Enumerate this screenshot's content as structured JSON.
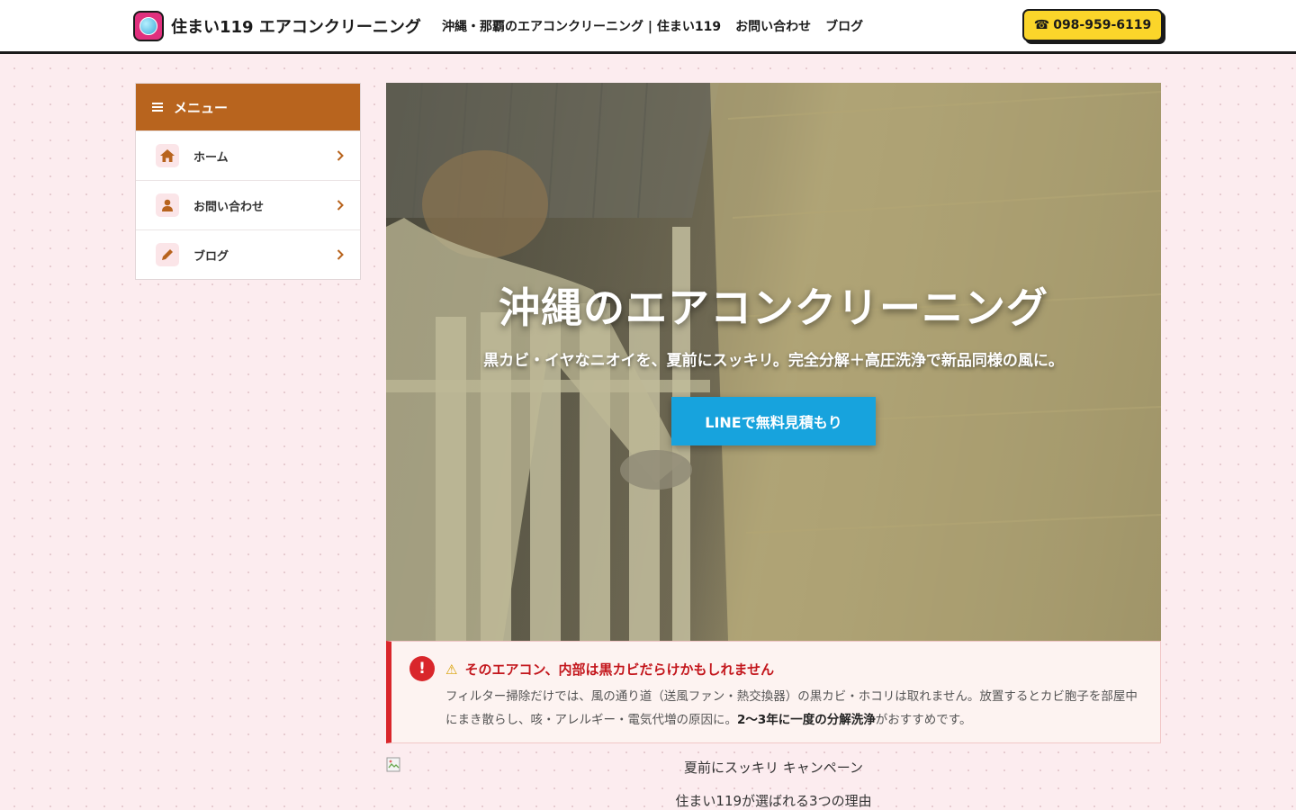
{
  "header": {
    "site_title": "住まい119 エアコンクリーニング",
    "nav": [
      {
        "label": "沖縄・那覇のエアコンクリーニング | 住まい119"
      },
      {
        "label": "お問い合わせ"
      },
      {
        "label": "ブログ"
      }
    ],
    "phone_icon": "☎",
    "phone": "098-959-6119"
  },
  "sidebar": {
    "title": "メニュー",
    "items": [
      {
        "label": "ホーム",
        "icon": "home-icon"
      },
      {
        "label": "お問い合わせ",
        "icon": "user-icon"
      },
      {
        "label": "ブログ",
        "icon": "pencil-icon"
      }
    ]
  },
  "hero": {
    "title": "沖縄のエアコンクリーニング",
    "subtitle": "黒カビ・イヤなニオイを、夏前にスッキリ。完全分解＋高圧洗浄で新品同様の風に。",
    "cta_label": "LINEで無料見積もり"
  },
  "alert": {
    "icon_text": "!",
    "warning_glyph": "⚠",
    "title": "そのエアコン、内部は黒カビだらけかもしれません",
    "body_part1": "フィルター掃除だけでは、風の通り道（送風ファン・熱交換器）の黒カビ・ホコリは取れません。放置するとカビ胞子を部屋中にまき散らし、咳・アレルギー・電気代増の原因に。",
    "body_bold": "2〜3年に一度の分解洗浄",
    "body_part2": "がおすすめです。"
  },
  "campaign_alt": "夏前にスッキリ キャンペーン",
  "reasons_heading": "住まい119が選ばれる3つの理由",
  "colors": {
    "page_bg": "#fcecef",
    "sidebar_header": "#b8641e",
    "phone_button": "#fbd52a",
    "cta_button": "#17a3dd",
    "alert_accent": "#d9262b",
    "logo": "#e0307e"
  }
}
